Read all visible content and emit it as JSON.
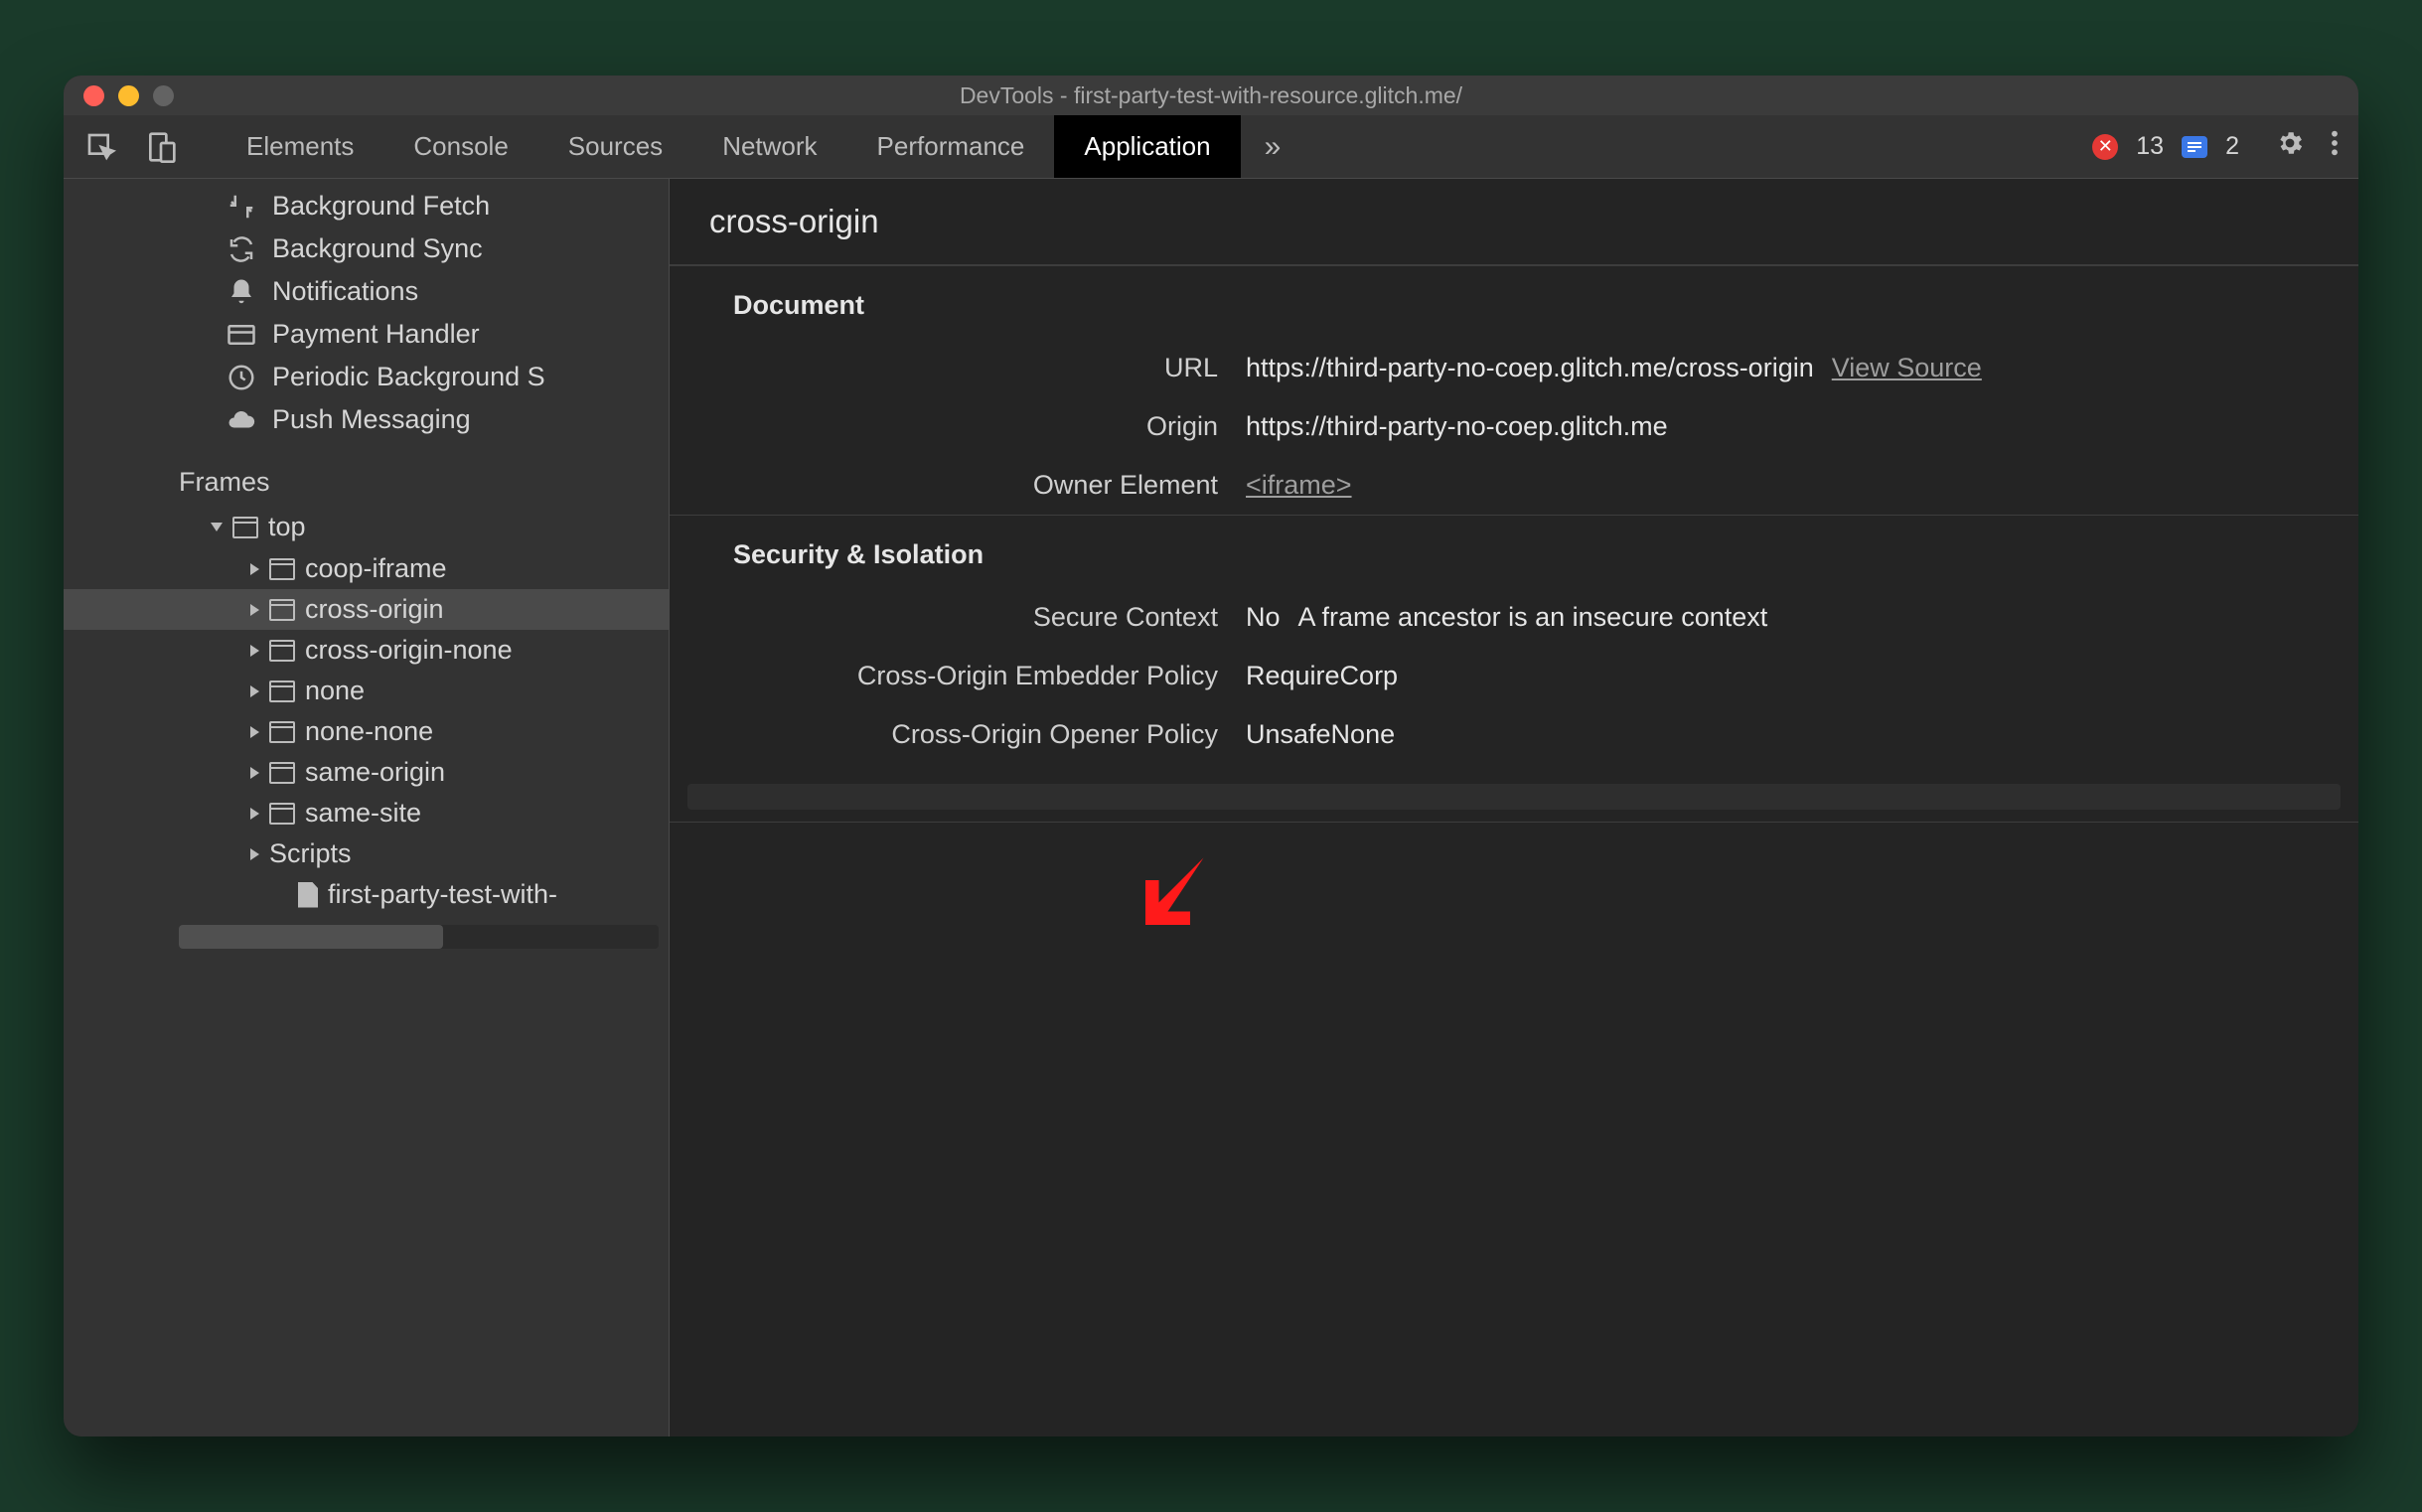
{
  "window": {
    "title": "DevTools - first-party-test-with-resource.glitch.me/"
  },
  "toolbar": {
    "tabs": [
      "Elements",
      "Console",
      "Sources",
      "Network",
      "Performance",
      "Application"
    ],
    "active_tab": "Application",
    "error_count": "13",
    "info_count": "2"
  },
  "sidebar": {
    "services": [
      {
        "icon": "fetch",
        "label": "Background Fetch"
      },
      {
        "icon": "sync",
        "label": "Background Sync"
      },
      {
        "icon": "bell",
        "label": "Notifications"
      },
      {
        "icon": "card",
        "label": "Payment Handler"
      },
      {
        "icon": "clock",
        "label": "Periodic Background S"
      },
      {
        "icon": "cloud",
        "label": "Push Messaging"
      }
    ],
    "frames_label": "Frames",
    "top_label": "top",
    "frames": [
      {
        "label": "coop-iframe"
      },
      {
        "label": "cross-origin",
        "selected": true
      },
      {
        "label": "cross-origin-none"
      },
      {
        "label": "none"
      },
      {
        "label": "none-none"
      },
      {
        "label": "same-origin"
      },
      {
        "label": "same-site"
      }
    ],
    "scripts_label": "Scripts",
    "script_file": "first-party-test-with-"
  },
  "main": {
    "title": "cross-origin",
    "document": {
      "heading": "Document",
      "url_label": "URL",
      "url_value": "https://third-party-no-coep.glitch.me/cross-origin",
      "view_source": "View Source",
      "origin_label": "Origin",
      "origin_value": "https://third-party-no-coep.glitch.me",
      "owner_label": "Owner Element",
      "owner_value": "<iframe>"
    },
    "security": {
      "heading": "Security & Isolation",
      "secure_label": "Secure Context",
      "secure_value": "No",
      "secure_note": "A frame ancestor is an insecure context",
      "coep_label": "Cross-Origin Embedder Policy",
      "coep_value": "RequireCorp",
      "coop_label": "Cross-Origin Opener Policy",
      "coop_value": "UnsafeNone"
    }
  }
}
